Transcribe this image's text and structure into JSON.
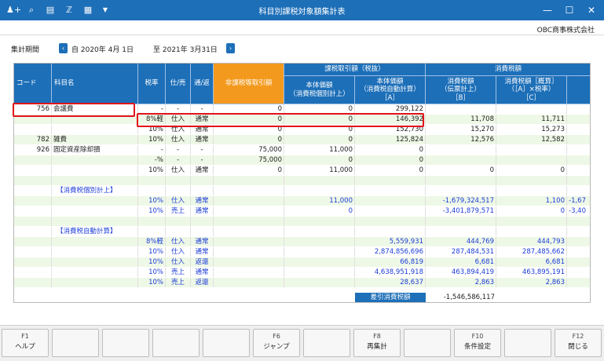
{
  "window": {
    "title": "科目別課税対象額集計表",
    "company": "OBC商事株式会社"
  },
  "period": {
    "label": "集計期間",
    "start": "自 2020年  4月 1日",
    "end": "至 2021年  3月31日"
  },
  "headers": {
    "code": "コード",
    "account": "科目名",
    "rate": "税率",
    "shi": "仕/売",
    "tsu": "通/返",
    "nontax": "非課税等取引額",
    "taxable_group": "課税取引額（税抜）",
    "hontai1": "本体価額\n（消費税個別計上）",
    "hontai2": "本体価額\n（消費税自動計算）\n［A］",
    "tax_group": "消費税額",
    "tax1": "消費税額\n（伝票計上）\n［B］",
    "tax2": "消費税額［概算］\n（［A］×税率）\n［C］"
  },
  "rows": [
    {
      "code": "756",
      "name": "会議費",
      "rate": "-",
      "shi": "-",
      "tsu": "-",
      "non": "0",
      "h1": "0",
      "h2": "299,122",
      "t1": "",
      "t2": "",
      "t3": ""
    },
    {
      "code": "",
      "name": "",
      "rate": "8%軽",
      "shi": "仕入",
      "tsu": "通常",
      "non": "0",
      "h1": "0",
      "h2": "146,392",
      "t1": "11,708",
      "t2": "11,711",
      "t3": ""
    },
    {
      "code": "",
      "name": "",
      "rate": "10%",
      "shi": "仕入",
      "tsu": "通常",
      "non": "0",
      "h1": "0",
      "h2": "152,730",
      "t1": "15,270",
      "t2": "15,273",
      "t3": ""
    },
    {
      "code": "782",
      "name": "雑費",
      "rate": "10%",
      "shi": "仕入",
      "tsu": "通常",
      "non": "0",
      "h1": "0",
      "h2": "125,824",
      "t1": "12,576",
      "t2": "12,582",
      "t3": ""
    },
    {
      "code": "926",
      "name": "固定資産除却損",
      "rate": "-",
      "shi": "-",
      "tsu": "-",
      "non": "75,000",
      "h1": "11,000",
      "h2": "0",
      "t1": "",
      "t2": "",
      "t3": ""
    },
    {
      "code": "",
      "name": "",
      "rate": "-%",
      "shi": "-",
      "tsu": "-",
      "non": "75,000",
      "h1": "0",
      "h2": "0",
      "t1": "",
      "t2": "",
      "t3": ""
    },
    {
      "code": "",
      "name": "",
      "rate": "10%",
      "shi": "仕入",
      "tsu": "通常",
      "non": "0",
      "h1": "11,000",
      "h2": "0",
      "t1": "0",
      "t2": "0",
      "t3": ""
    },
    {
      "code": "",
      "name": "",
      "rate": "",
      "shi": "",
      "tsu": "",
      "non": "",
      "h1": "",
      "h2": "",
      "t1": "",
      "t2": "",
      "t3": ""
    },
    {
      "code": "",
      "name": "【消費税個別計上】",
      "rate": "",
      "shi": "",
      "tsu": "",
      "non": "",
      "h1": "",
      "h2": "",
      "t1": "",
      "t2": "",
      "t3": "",
      "blue": true
    },
    {
      "code": "",
      "name": "",
      "rate": "10%",
      "shi": "仕入",
      "tsu": "通常",
      "non": "",
      "h1": "11,000",
      "h2": "",
      "t1": "-1,679,324,517",
      "t2": "1,100",
      "t3": "-1,67",
      "blue": true
    },
    {
      "code": "",
      "name": "",
      "rate": "10%",
      "shi": "売上",
      "tsu": "通常",
      "non": "",
      "h1": "0",
      "h2": "",
      "t1": "-3,401,879,571",
      "t2": "0",
      "t3": "-3,40",
      "blue": true
    },
    {
      "code": "",
      "name": "",
      "rate": "",
      "shi": "",
      "tsu": "",
      "non": "",
      "h1": "",
      "h2": "",
      "t1": "",
      "t2": "",
      "t3": ""
    },
    {
      "code": "",
      "name": "【消費税自動計算】",
      "rate": "",
      "shi": "",
      "tsu": "",
      "non": "",
      "h1": "",
      "h2": "",
      "t1": "",
      "t2": "",
      "t3": "",
      "blue": true
    },
    {
      "code": "",
      "name": "",
      "rate": "8%軽",
      "shi": "仕入",
      "tsu": "通常",
      "non": "",
      "h1": "",
      "h2": "5,559,931",
      "t1": "444,769",
      "t2": "444,793",
      "t3": "",
      "blue": true
    },
    {
      "code": "",
      "name": "",
      "rate": "10%",
      "shi": "仕入",
      "tsu": "通常",
      "non": "",
      "h1": "",
      "h2": "2,874,856,696",
      "t1": "287,484,531",
      "t2": "287,485,662",
      "t3": "",
      "blue": true
    },
    {
      "code": "",
      "name": "",
      "rate": "10%",
      "shi": "仕入",
      "tsu": "返還",
      "non": "",
      "h1": "",
      "h2": "66,819",
      "t1": "6,681",
      "t2": "6,681",
      "t3": "",
      "blue": true
    },
    {
      "code": "",
      "name": "",
      "rate": "10%",
      "shi": "売上",
      "tsu": "通常",
      "non": "",
      "h1": "",
      "h2": "4,638,951,918",
      "t1": "463,894,419",
      "t2": "463,895,191",
      "t3": "",
      "blue": true
    },
    {
      "code": "",
      "name": "",
      "rate": "10%",
      "shi": "売上",
      "tsu": "返還",
      "non": "",
      "h1": "",
      "h2": "28,637",
      "t1": "2,863",
      "t2": "2,863",
      "t3": "",
      "blue": true
    }
  ],
  "summary": {
    "label": "差引消費税額",
    "value": "-1,546,586,117"
  },
  "fkeys": [
    {
      "fn": "F1",
      "label": "ヘルプ"
    },
    {
      "fn": "",
      "label": ""
    },
    {
      "fn": "",
      "label": ""
    },
    {
      "fn": "",
      "label": ""
    },
    {
      "fn": "",
      "label": ""
    },
    {
      "fn": "F6",
      "label": "ジャンプ"
    },
    {
      "fn": "",
      "label": ""
    },
    {
      "fn": "F8",
      "label": "再集計"
    },
    {
      "fn": "",
      "label": ""
    },
    {
      "fn": "F10",
      "label": "条件設定"
    },
    {
      "fn": "",
      "label": ""
    },
    {
      "fn": "F12",
      "label": "閉じる"
    }
  ]
}
